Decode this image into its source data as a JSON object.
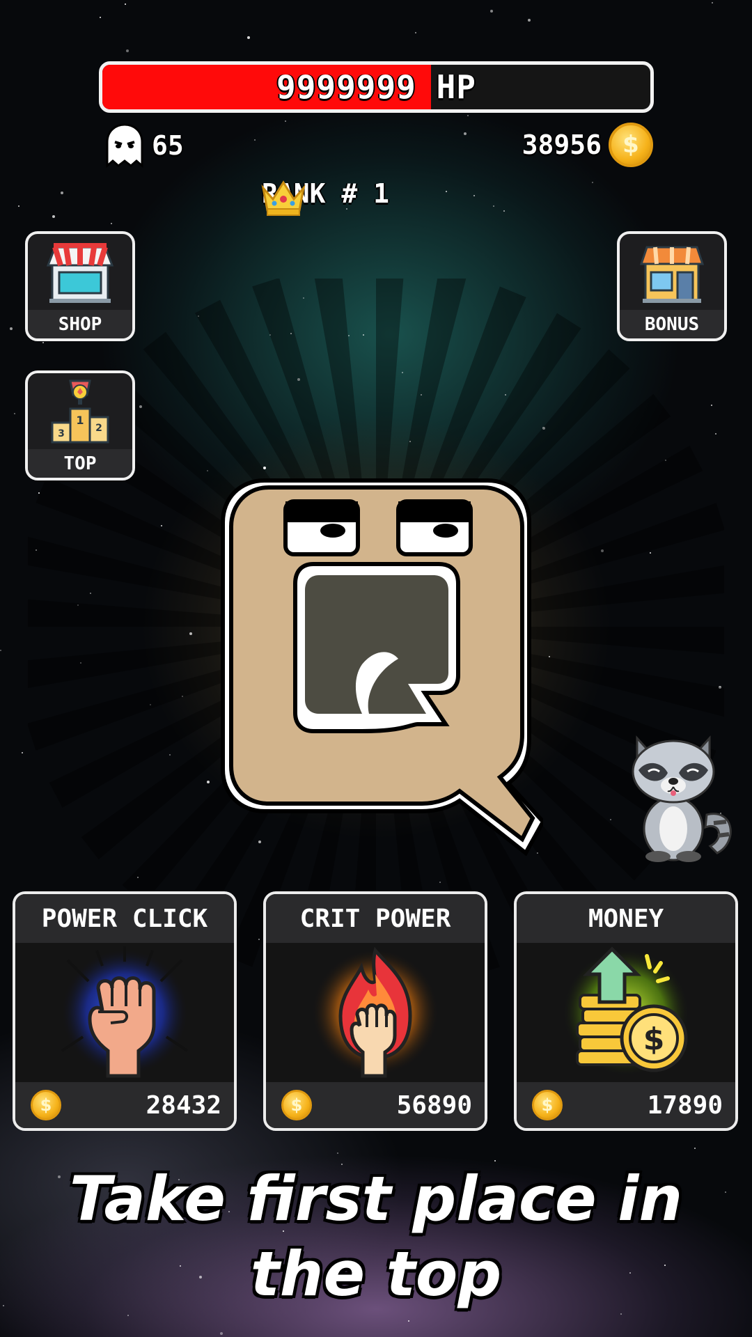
{
  "hp": {
    "text": "9999999 HP",
    "fill_fraction": 0.6
  },
  "kills": {
    "icon": "ghost-icon",
    "value": "65"
  },
  "coins": {
    "icon": "coin-icon",
    "value": "38956",
    "symbol": "$"
  },
  "rank": {
    "icon": "crown-icon",
    "label": "RANK # 1"
  },
  "side_buttons": {
    "shop": {
      "label": "SHOP",
      "icon": "shop-icon"
    },
    "bonus": {
      "label": "BONUS",
      "icon": "store-icon"
    },
    "top": {
      "label": "TOP",
      "icon": "podium-icon"
    }
  },
  "upgrades": [
    {
      "title": "POWER CLICK",
      "icon": "fist-icon",
      "price": "28432"
    },
    {
      "title": "CRIT POWER",
      "icon": "fire-fist-icon",
      "price": "56890"
    },
    {
      "title": "MONEY",
      "icon": "money-growth-icon",
      "price": "17890"
    }
  ],
  "tagline": "Take first place in the top",
  "colors": {
    "hp_red": "#ff0a0a",
    "coin_gold": "#f6b21a",
    "monster_skin": "#d2b48c"
  }
}
